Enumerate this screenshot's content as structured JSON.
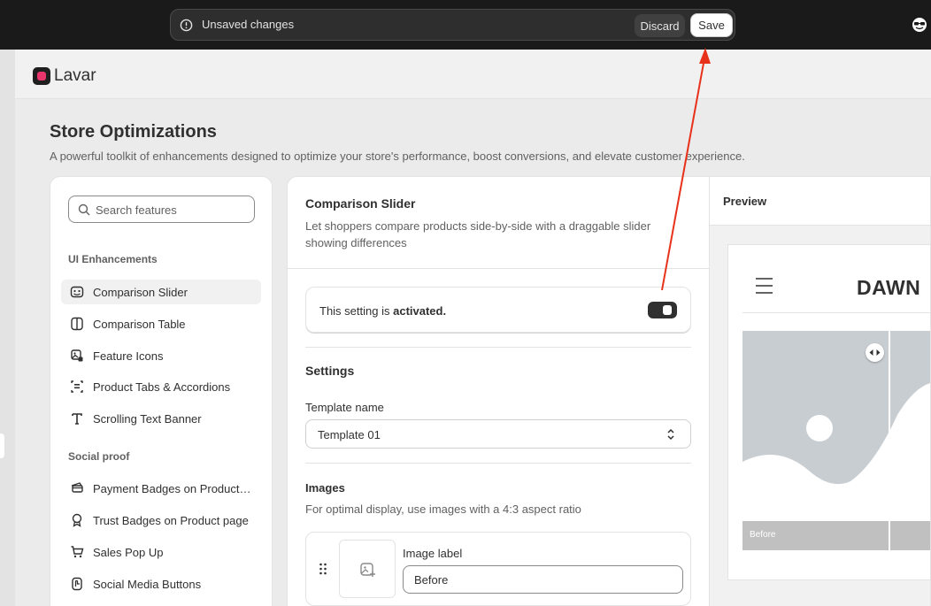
{
  "topbar": {
    "status_text": "Unsaved changes",
    "discard_label": "Discard",
    "save_label": "Save"
  },
  "app": {
    "name": "Lavar"
  },
  "page": {
    "title": "Store Optimizations",
    "subtitle": "A powerful toolkit of enhancements designed to optimize your store's performance, boost conversions, and elevate customer experience."
  },
  "sidebar": {
    "search_placeholder": "Search features",
    "groups": [
      {
        "label": "UI Enhancements",
        "items": [
          {
            "label": "Comparison Slider",
            "icon": "comparison-slider-icon",
            "active": true
          },
          {
            "label": "Comparison Table",
            "icon": "columns-icon"
          },
          {
            "label": "Feature Icons",
            "icon": "image-icon"
          },
          {
            "label": "Product Tabs & Accordions",
            "icon": "tabs-icon"
          },
          {
            "label": "Scrolling Text Banner",
            "icon": "text-icon"
          }
        ]
      },
      {
        "label": "Social proof",
        "items": [
          {
            "label": "Payment Badges on Product page",
            "icon": "payment-icon"
          },
          {
            "label": "Trust Badges on Product page",
            "icon": "badge-icon"
          },
          {
            "label": "Sales Pop Up",
            "icon": "cart-icon"
          },
          {
            "label": "Social Media Buttons",
            "icon": "touch-icon"
          }
        ]
      }
    ]
  },
  "feature": {
    "title": "Comparison Slider",
    "description": "Let shoppers compare products side-by-side with a draggable slider showing differences",
    "status_prefix": "This setting is",
    "status_value": "activated.",
    "settings_heading": "Settings",
    "template_label": "Template name",
    "template_value": "Template 01",
    "images_heading": "Images",
    "images_hint": "For optimal display, use images with a 4:3 aspect ratio",
    "image_label": "Image label",
    "image_label_value": "Before"
  },
  "preview": {
    "heading": "Preview",
    "store_name": "DAWN",
    "before_label": "Before"
  },
  "colors": {
    "topbar": "#1a1a1a",
    "accent": "#e8356b",
    "annotation_arrow": "#e8311a"
  }
}
